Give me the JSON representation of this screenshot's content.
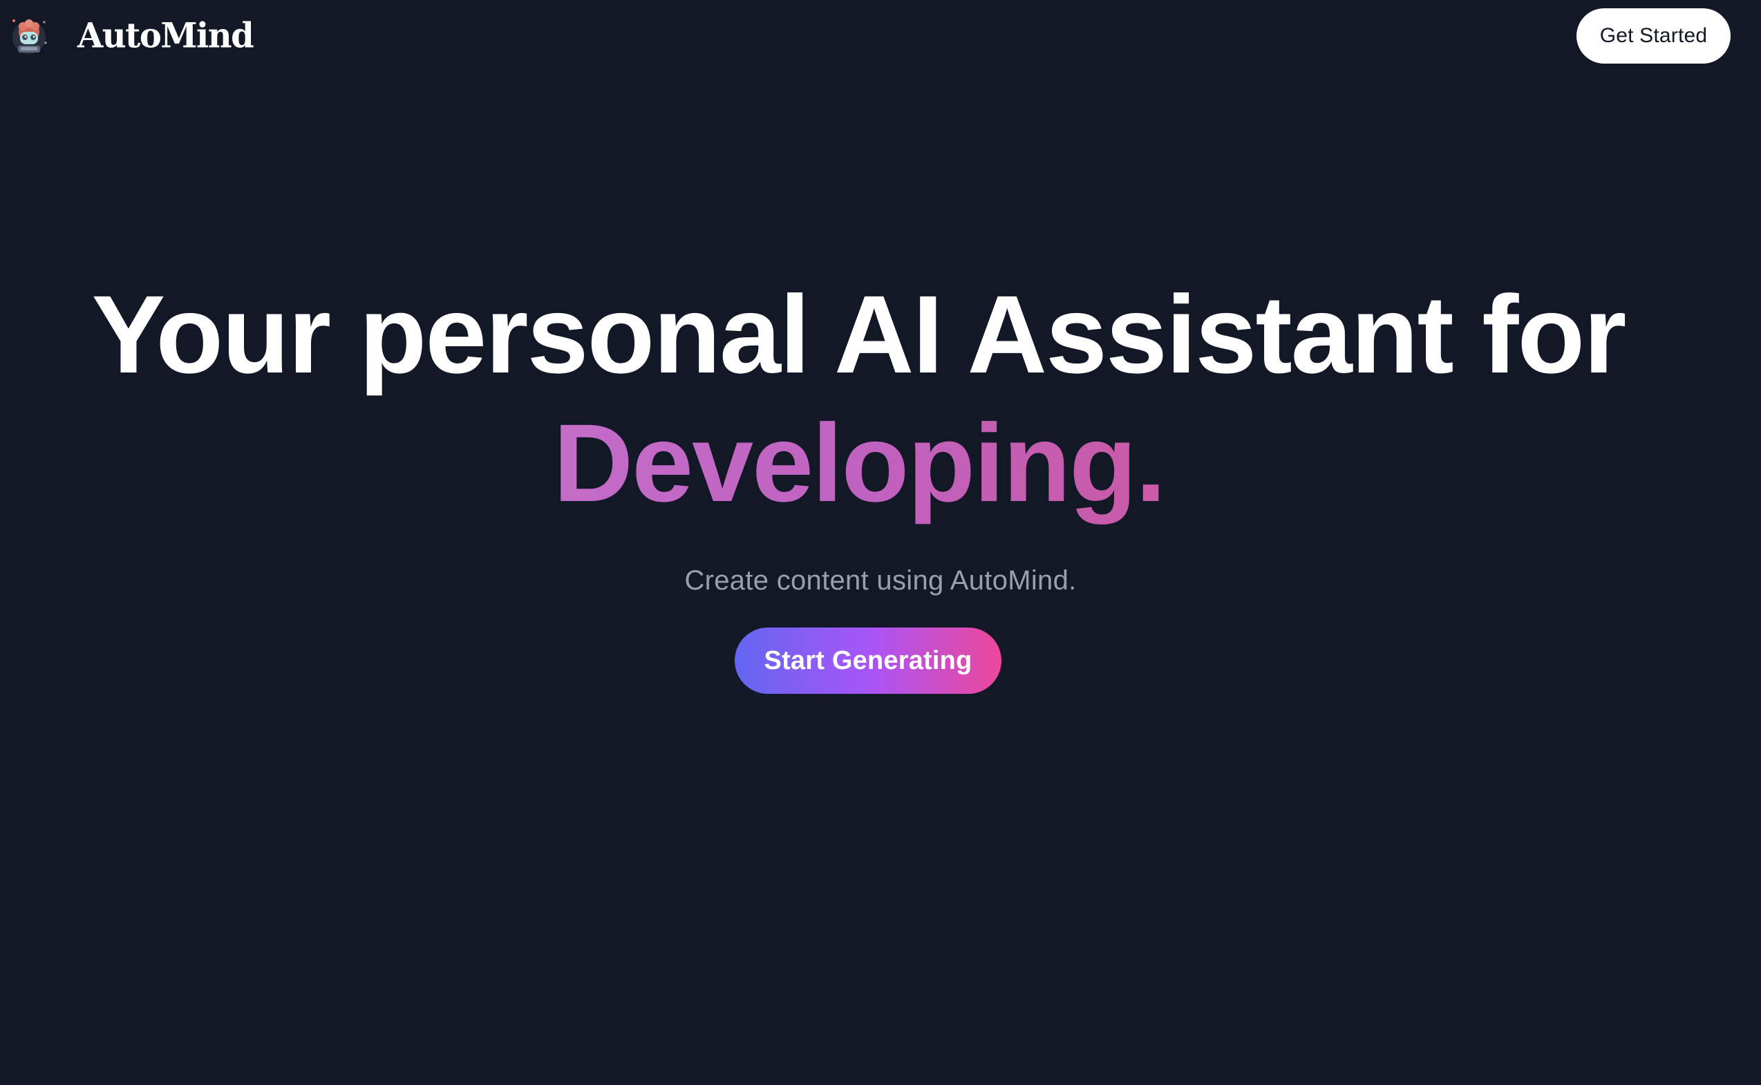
{
  "header": {
    "brand_name": "AutoMind",
    "logo_icon": "robot-avatar-icon",
    "get_started_label": "Get Started"
  },
  "hero": {
    "headline_line1": "Your personal AI Assistant for",
    "headline_highlight": "Developing.",
    "subtitle": "Create content using AutoMind.",
    "cta_label": "Start Generating"
  },
  "colors": {
    "background": "#131826",
    "headline_text": "#ffffff",
    "highlight_gradient": [
      "#c46cc9",
      "#c95aa6"
    ],
    "subtitle_text": "#9aa0ab",
    "cta_gradient": [
      "#6366f1",
      "#a855f7",
      "#ec4899"
    ],
    "get_started_bg": "#ffffff",
    "get_started_text": "#131826"
  }
}
